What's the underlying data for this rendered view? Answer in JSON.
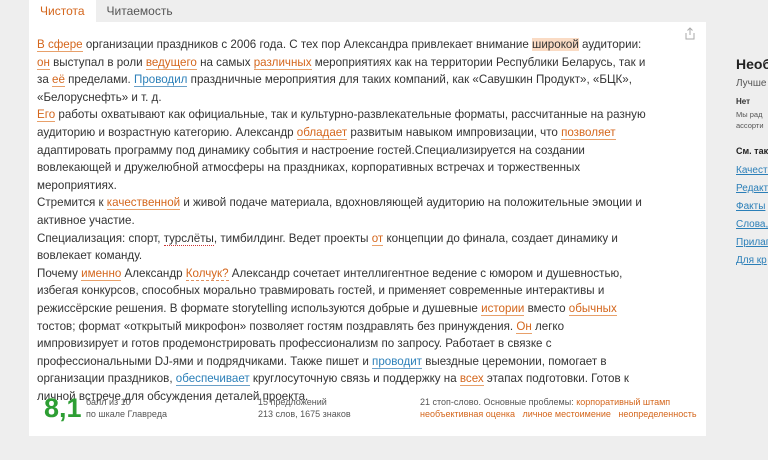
{
  "tabs": [
    "Чистота",
    "Читаемость"
  ],
  "text": {
    "p1": [
      {
        "t": "В сфере",
        "c": "hl-o"
      },
      {
        "t": " организации праздников с 2006 года. С тех пор Александра привлекает внимание "
      },
      {
        "t": "широкой",
        "c": "hl-bg"
      },
      {
        "t": " аудитории: "
      },
      {
        "t": "он",
        "c": "hl-o"
      },
      {
        "t": " выступал в роли "
      },
      {
        "t": "ведущего",
        "c": "hl-o"
      },
      {
        "t": " на самых "
      },
      {
        "t": "различных",
        "c": "hl-o"
      },
      {
        "t": " мероприятиях как на территории Республики Беларусь, так и за "
      },
      {
        "t": "её",
        "c": "hl-o"
      },
      {
        "t": " пределами. "
      },
      {
        "t": "Проводил",
        "c": "hl-b"
      },
      {
        "t": " праздничные мероприятия для таких компаний, как «Савушкин Продукт», «БЦК», «Белоруснефть» и т. д."
      }
    ],
    "p2": [
      {
        "t": "Его",
        "c": "hl-o"
      },
      {
        "t": " работы охватывают как официальные, так и культурно-развлекательные форматы, рассчитанные на разную аудиторию и возрастную категорию. Александр "
      },
      {
        "t": "обладает",
        "c": "hl-o"
      },
      {
        "t": " развитым навыком импровизации, что "
      },
      {
        "t": "позволяет",
        "c": "hl-o"
      },
      {
        "t": " адаптировать программу под динамику события и настроение гостей.Специализируется на создании вовлекающей и дружелюбной атмосферы на праздниках, корпоративных встречах и торжественных мероприятиях."
      }
    ],
    "p3": [
      {
        "t": "Стремится к "
      },
      {
        "t": "качественной",
        "c": "hl-o"
      },
      {
        "t": " и живой подаче материала, вдохновляющей аудиторию на положительные эмоции и "
      },
      {
        "t": "активное",
        "c": "hl-w"
      },
      {
        "t": " участие."
      }
    ],
    "p4": [
      {
        "t": "Специализация: спорт, "
      },
      {
        "t": "турслёты",
        "c": "hl-r"
      },
      {
        "t": ", тимбилдинг. Ведет проекты "
      },
      {
        "t": "от",
        "c": "hl-o"
      },
      {
        "t": " концепции до финала, создает динамику и вовлекает команду."
      }
    ],
    "p5": [
      {
        "t": "Почему "
      },
      {
        "t": "именно",
        "c": "hl-o"
      },
      {
        "t": " Александр "
      },
      {
        "t": "Колчук?",
        "c": "hl-dash"
      },
      {
        "t": " Александр сочетает интеллигентное ведение с юмором и душевностью, избегая конкурсов, способных морально травмировать гостей, и применяет современные интерактивы и режиссёрские решения. В формате storytelling используются добрые и душевные "
      },
      {
        "t": "истории",
        "c": "hl-o"
      },
      {
        "t": " вместо "
      },
      {
        "t": "обычных",
        "c": "hl-o"
      },
      {
        "t": " тостов; формат «открытый микрофон» позволяет гостям поздравлять без принуждения. "
      },
      {
        "t": "Он",
        "c": "hl-o"
      },
      {
        "t": " легко импровизирует и готов продемонстрировать профессионализм по запросу. Работает в связке с профессиональными DJ-ями и подрядчиками. Также пишет и "
      },
      {
        "t": "проводит",
        "c": "hl-b"
      },
      {
        "t": " выездные церемонии, помогает в организации праздников, "
      },
      {
        "t": "обеспечивает",
        "c": "hl-b"
      },
      {
        "t": " круглосуточную связь и поддержку на "
      },
      {
        "t": "всех",
        "c": "hl-o"
      },
      {
        "t": " этапах подготовки. Готов к личной встрече для обсуждения деталей проекта."
      }
    ]
  },
  "score": {
    "value": "8,1",
    "caption_line1": "балл из 10",
    "caption_line2": "по шкале Главреда"
  },
  "stats": {
    "line1": "15 предложений",
    "line2": "213 слов, 1675 знаков"
  },
  "problems": {
    "prefix": "21 стоп-слово. Основные проблемы:",
    "items": [
      "корпоративный штамп",
      "необъективная оценка",
      "личное местоимение",
      "неопределенность"
    ]
  },
  "sidebar": {
    "heading": "Необходимо",
    "subtitle": "Лучше",
    "note_title": "Нет",
    "note_text1": "Мы рад",
    "note_text2": "ассорти",
    "see_also": "См. так",
    "links": [
      "Качеств",
      "Редакт",
      "Факты",
      "Слова,",
      "Прилаг",
      "Для кр"
    ]
  },
  "colors": {
    "accent": "#d4661c",
    "link": "#2b7fb8",
    "score": "#2d9e33"
  }
}
